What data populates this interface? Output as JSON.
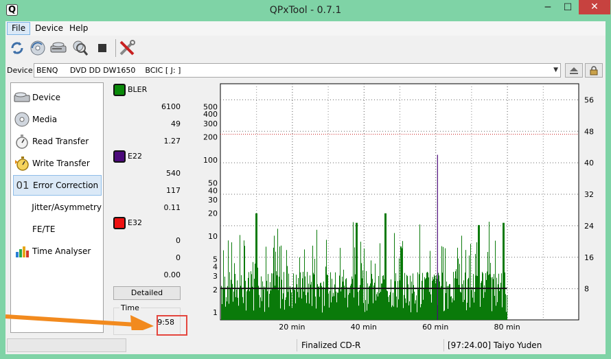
{
  "window": {
    "title": "QPxTool - 0.7.1",
    "icon_letter": "Q",
    "minimize": "─",
    "maximize": "☐",
    "close": "✕"
  },
  "menu": [
    {
      "label": "File"
    },
    {
      "label": "Device"
    },
    {
      "label": "Help"
    }
  ],
  "toolbar": {
    "icons": [
      "refresh-icon",
      "disc-refresh-icon",
      "eject-icon",
      "scan-icon",
      "stop-icon",
      "settings-tools-icon"
    ]
  },
  "device": {
    "label": "Device:",
    "value": "BENQ     DVD DD DW1650    BCIC [ J: ]"
  },
  "sidebar": {
    "items": [
      {
        "label": "Device",
        "icon": "drive-icon"
      },
      {
        "label": "Media",
        "icon": "disc-icon"
      },
      {
        "label": "Read Transfer",
        "icon": "stopwatch-icon"
      },
      {
        "label": "Write Transfer",
        "icon": "write-stopwatch-icon"
      },
      {
        "label": "Error Correction",
        "icon_text": "01"
      },
      {
        "label": "Jitter/Asymmetry"
      },
      {
        "label": "FE/TE"
      },
      {
        "label": "Time Analyser",
        "icon": "bar-chart-icon"
      }
    ]
  },
  "stats": {
    "bler": {
      "label": "BLER",
      "color": "#0a8a0a",
      "values": [
        "6100",
        "49",
        "1.27"
      ]
    },
    "e22": {
      "label": "E22",
      "color": "#4b0a7a",
      "values": [
        "540",
        "117",
        "0.11"
      ]
    },
    "e32": {
      "label": "E32",
      "color": "#ee1111",
      "values": [
        "0",
        "0",
        "0.00"
      ]
    },
    "detailed_button": "Detailed",
    "time_label": "Time",
    "time_value": "9:58"
  },
  "status": {
    "disc_type": "Finalized CD-R",
    "disc_info": "[97:24.00] Taiyo Yuden"
  },
  "chart_data": {
    "type": "bar",
    "x_unit": "min",
    "x_range": [
      0,
      100
    ],
    "x_ticks": [
      "20 min",
      "40 min",
      "60 min",
      "80 min"
    ],
    "x_tick_values": [
      20,
      40,
      60,
      80
    ],
    "data_end_min": 80,
    "y_left_scale": "log",
    "y_left_range": [
      0.8,
      1000
    ],
    "y_left_ticks": [
      "1",
      "2",
      "3",
      "4",
      "5",
      "10",
      "20",
      "30",
      "40",
      "50",
      "100",
      "200",
      "300",
      "400",
      "500"
    ],
    "y_left_tick_values": [
      1,
      2,
      3,
      4,
      5,
      10,
      20,
      30,
      40,
      50,
      100,
      200,
      300,
      400,
      500
    ],
    "y_right_range": [
      0,
      60
    ],
    "y_right_ticks": [
      "8",
      "16",
      "24",
      "32",
      "40",
      "48",
      "56"
    ],
    "y_right_tick_values": [
      8,
      16,
      24,
      32,
      40,
      48,
      56
    ],
    "threshold_value": 220,
    "threshold_color": "#cc2222",
    "avg_speed_value": 8,
    "grid": true,
    "series": [
      {
        "name": "BLER",
        "color": "#0a7a0a",
        "peak_values": [
          [
            10,
            20
          ],
          [
            38,
            15
          ],
          [
            46,
            20
          ],
          [
            72,
            14
          ],
          [
            79,
            15
          ]
        ]
      },
      {
        "name": "E22",
        "color": "#4b0a7a",
        "peak_values": [
          [
            60.5,
            117
          ]
        ]
      }
    ]
  }
}
